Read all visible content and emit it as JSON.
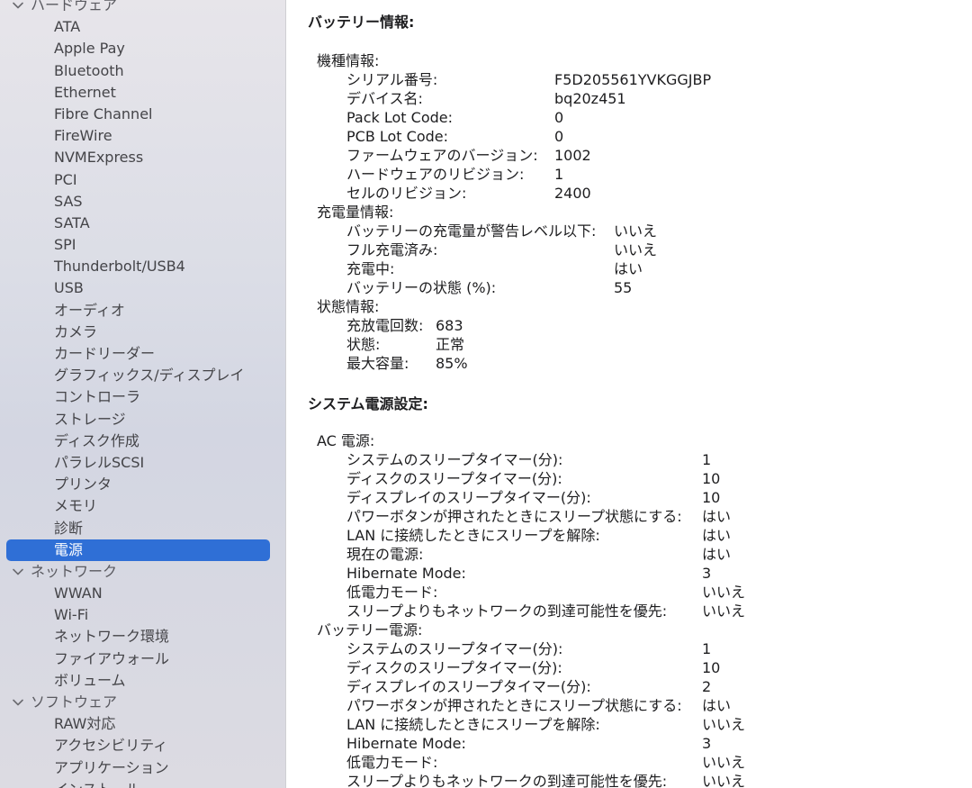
{
  "sidebar": {
    "groups": [
      {
        "label": "ハードウェア",
        "items": [
          "ATA",
          "Apple Pay",
          "Bluetooth",
          "Ethernet",
          "Fibre Channel",
          "FireWire",
          "NVMExpress",
          "PCI",
          "SAS",
          "SATA",
          "SPI",
          "Thunderbolt/USB4",
          "USB",
          "オーディオ",
          "カメラ",
          "カードリーダー",
          "グラフィックス/ディスプレイ",
          "コントローラ",
          "ストレージ",
          "ディスク作成",
          "パラレルSCSI",
          "プリンタ",
          "メモリ",
          "診断",
          "電源"
        ]
      },
      {
        "label": "ネットワーク",
        "items": [
          "WWAN",
          "Wi-Fi",
          "ネットワーク環境",
          "ファイアウォール",
          "ボリューム"
        ]
      },
      {
        "label": "ソフトウェア",
        "items": [
          "RAW対応",
          "アクセシビリティ",
          "アプリケーション",
          "インストール"
        ]
      }
    ],
    "selected": "電源"
  },
  "battery": {
    "title": "バッテリー情報:",
    "model": {
      "heading": "機種情報:",
      "rows": [
        {
          "k": "シリアル番号:",
          "v": "F5D205561YVKGGJBP"
        },
        {
          "k": "デバイス名:",
          "v": "bq20z451"
        },
        {
          "k": "Pack Lot Code:",
          "v": "0"
        },
        {
          "k": "PCB Lot Code:",
          "v": "0"
        },
        {
          "k": "ファームウェアのバージョン:",
          "v": "1002"
        },
        {
          "k": "ハードウェアのリビジョン:",
          "v": "1"
        },
        {
          "k": "セルのリビジョン:",
          "v": "2400"
        }
      ]
    },
    "charge": {
      "heading": "充電量情報:",
      "rows": [
        {
          "k": "バッテリーの充電量が警告レベル以下:",
          "v": "いいえ"
        },
        {
          "k": "フル充電済み:",
          "v": "いいえ"
        },
        {
          "k": "充電中:",
          "v": "はい"
        },
        {
          "k": "バッテリーの状態 (%):",
          "v": "55"
        }
      ]
    },
    "health": {
      "heading": "状態情報:",
      "rows": [
        {
          "k": "充放電回数:",
          "v": "683"
        },
        {
          "k": "状態:",
          "v": "正常"
        },
        {
          "k": "最大容量:",
          "v": "85%"
        }
      ]
    }
  },
  "power": {
    "title": "システム電源設定:",
    "ac": {
      "heading": "AC 電源:",
      "rows": [
        {
          "k": "システムのスリープタイマー(分):",
          "v": "1"
        },
        {
          "k": "ディスクのスリープタイマー(分):",
          "v": "10"
        },
        {
          "k": "ディスプレイのスリープタイマー(分):",
          "v": "10"
        },
        {
          "k": "パワーボタンが押されたときにスリープ状態にする:",
          "v": "はい"
        },
        {
          "k": "LAN に接続したときにスリープを解除:",
          "v": "はい"
        },
        {
          "k": "現在の電源:",
          "v": "はい"
        },
        {
          "k": "Hibernate Mode:",
          "v": "3"
        },
        {
          "k": "低電力モード:",
          "v": "いいえ"
        },
        {
          "k": "スリープよりもネットワークの到達可能性を優先:",
          "v": "いいえ"
        }
      ]
    },
    "battery": {
      "heading": "バッテリー電源:",
      "rows": [
        {
          "k": "システムのスリープタイマー(分):",
          "v": "1"
        },
        {
          "k": "ディスクのスリープタイマー(分):",
          "v": "10"
        },
        {
          "k": "ディスプレイのスリープタイマー(分):",
          "v": "2"
        },
        {
          "k": "パワーボタンが押されたときにスリープ状態にする:",
          "v": "はい"
        },
        {
          "k": "LAN に接続したときにスリープを解除:",
          "v": "いいえ"
        },
        {
          "k": "Hibernate Mode:",
          "v": "3"
        },
        {
          "k": "低電力モード:",
          "v": "いいえ"
        },
        {
          "k": "スリープよりもネットワークの到達可能性を優先:",
          "v": "いいえ"
        }
      ]
    }
  }
}
